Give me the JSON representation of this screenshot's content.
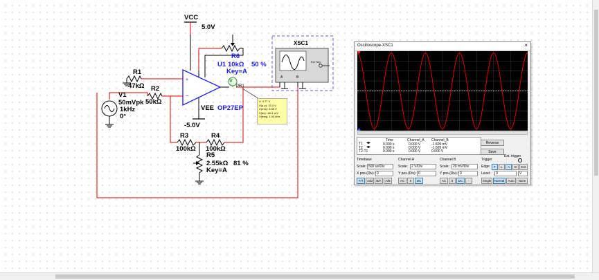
{
  "schematic": {
    "vcc_label": "VCC",
    "vcc_value": "5.0V",
    "vee_label": "VEE",
    "vee_value": "-5.0V",
    "r6_name": "R6",
    "r6_value": "10kΩ",
    "r6_percent": "50 %",
    "r6_key": "Key=A",
    "u1_name": "U1",
    "u1_part": "OP27EP",
    "r1_name": "R1",
    "r1_value": "47kΩ",
    "r2_name": "R2",
    "r2_value": "50kΩ",
    "v1_name": "V1",
    "v1_amp": "50mVpk",
    "v1_freq": "1kHz",
    "v1_phase": "0°",
    "r3_name": "R3",
    "r3_value": "100kΩ",
    "r4_name": "R4",
    "r4_value": "100kΩ",
    "r5_name": "R5",
    "r5_value": "2.55kΩ",
    "r5_percent": "81 %",
    "r5_key": "Key=A",
    "probe_name": "PR1",
    "probe_icon": "V",
    "probe_lines": [
      "V: 3.77 V",
      "V(p-p): 15.3 V",
      "V(rms): 3.95 V",
      "V(dc): -86.1 mV",
      "V(freq): 1.00 kHz"
    ],
    "xsc_name": "XSC1",
    "xsc_ext_trig": "Ext Trig",
    "xsc_pin_a": "A",
    "xsc_pin_b": "B",
    "colors": {
      "wire": "#e00000",
      "label_blue": "#1a1aff",
      "instrument_border": "#5b5bd6"
    }
  },
  "oscilloscope": {
    "title": "Oscilloscope-XSC1",
    "close": "×",
    "measure_headers": {
      "time": "Time",
      "cha": "Channel_A",
      "chb": "Channel_B"
    },
    "rows": [
      {
        "label": "T1",
        "time": "0.000 s",
        "cha": "0.000 V",
        "chb": "-1.609 mV"
      },
      {
        "label": "T2",
        "time": "0.000 s",
        "cha": "0.000 V",
        "chb": "-1.609 mV"
      },
      {
        "label": "T2-T1",
        "time": "0.000 s",
        "cha": "0.000 V",
        "chb": "0.000 V"
      }
    ],
    "reverse_label": "Reverse",
    "save_label": "Save",
    "ext_trigger_label": "Ext. trigger",
    "timebase": {
      "title": "Timebase",
      "scale_label": "Scale:",
      "scale_value": "500 us/Div",
      "xpos_label": "X pos.(Div):",
      "xpos_value": "0",
      "modes": [
        "Y/T",
        "Add",
        "B/A",
        "A/B"
      ]
    },
    "channel_a": {
      "title": "Channel A",
      "scale_label": "Scale:",
      "scale_value": "2 V/Div",
      "ypos_label": "Y pos.(Div):",
      "ypos_value": "0",
      "coupling": [
        "AC",
        "0",
        "DC"
      ]
    },
    "channel_b": {
      "title": "Channel B",
      "scale_label": "Scale:",
      "scale_value": "20 mV/Div",
      "ypos_label": "Y pos.(Div):",
      "ypos_value": "0",
      "coupling": [
        "AC",
        "0",
        "DC",
        "-"
      ]
    },
    "trigger": {
      "title": "Trigger",
      "edge_label": "Edge:",
      "edge_buttons": [
        "F",
        "L",
        "A",
        "B",
        "Ext"
      ],
      "level_label": "Level:",
      "level_value": "0",
      "level_unit": "V",
      "modes": [
        "Single",
        "Normal",
        "Auto",
        "None"
      ]
    },
    "trace": {
      "color": "#e00000",
      "divisions_per_screen": 10,
      "volts_per_div": 2,
      "amplitude_vpk": 7.65,
      "cycles_on_screen": 5
    },
    "colors": {
      "screen": "#000000",
      "grid": "#4a4a4a",
      "cursor": "#ffffff"
    }
  }
}
